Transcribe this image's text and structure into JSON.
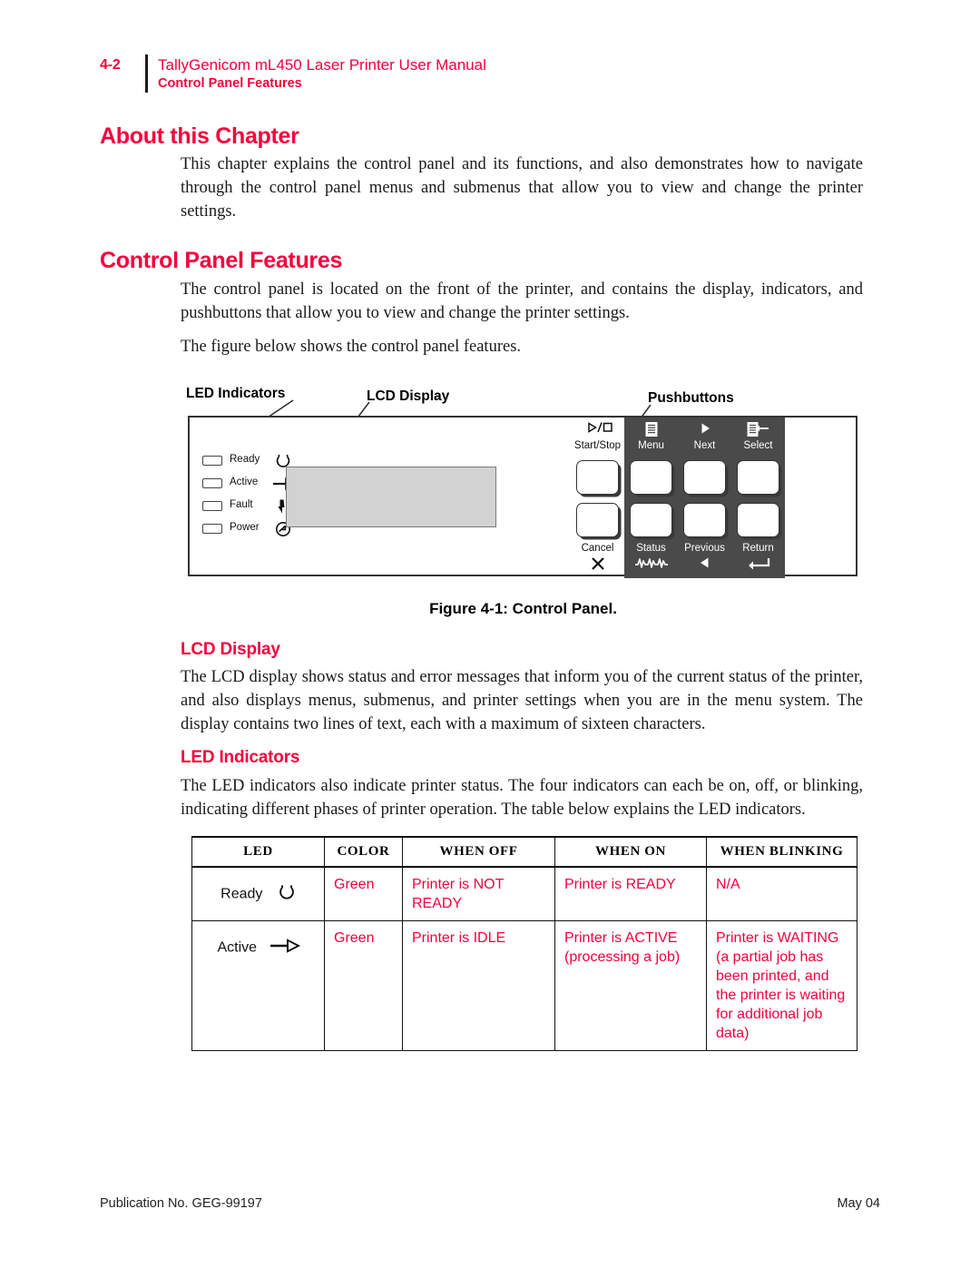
{
  "header": {
    "page_number": "4-2",
    "manual_title": "TallyGenicom mL450 Laser Printer User Manual",
    "section": "Control Panel Features"
  },
  "colors": {
    "accent_red": "#F5003C",
    "panel_outline": "#333333",
    "lcd_fill": "#D2D2D2",
    "key_dark": "#4A4A4A"
  },
  "sections": [
    {
      "heading": "About this Chapter",
      "paragraphs": [
        "This chapter explains the control panel and its functions, and also demonstrates how to navigate through the control panel menus and submenus that allow you to view and change the printer settings."
      ]
    },
    {
      "heading": "Control Panel Features",
      "paragraphs": [
        "The control panel is located on the front of the printer, and contains the display, indicators, and pushbuttons that allow you to view and change the printer settings.",
        "The figure below shows the control panel features."
      ]
    }
  ],
  "figure": {
    "callouts": {
      "led_indicators": "LED Indicators",
      "lcd_display": "LCD Display",
      "pushbuttons": "Pushbuttons"
    },
    "leds": [
      {
        "label": "Ready",
        "icon": "ready-circle-icon"
      },
      {
        "label": "Active",
        "icon": "active-arrow-icon"
      },
      {
        "label": "Fault",
        "icon": "fault-bolt-icon"
      },
      {
        "label": "Power",
        "icon": "power-icon"
      }
    ],
    "buttons_top": [
      {
        "label": "Start/Stop",
        "icon": "play-stop-icon",
        "dark": false
      },
      {
        "label": "Menu",
        "icon": "menu-list-icon",
        "dark": true
      },
      {
        "label": "Next",
        "icon": "right-triangle-icon",
        "dark": true
      },
      {
        "label": "Select",
        "icon": "select-arrow-icon",
        "dark": true
      }
    ],
    "buttons_bottom": [
      {
        "label": "Cancel",
        "icon": "x-icon",
        "dark": false
      },
      {
        "label": "Status",
        "icon": "waveform-icon",
        "dark": true
      },
      {
        "label": "Previous",
        "icon": "left-triangle-icon",
        "dark": true
      },
      {
        "label": "Return",
        "icon": "enter-arrow-icon",
        "dark": true
      }
    ],
    "caption": "Figure 4-1:  Control Panel."
  },
  "subsections": [
    {
      "heading": "LCD Display",
      "paragraph": "The LCD display shows status and error messages that inform you of the current status of the printer, and also displays menus, submenus, and printer settings when you are in the menu system. The display contains two lines of text, each with a maximum of sixteen characters."
    },
    {
      "heading": "LED Indicators",
      "paragraph": "The LED indicators also indicate printer status. The four indicators can each be on, off, or blinking, indicating different phases of printer operation. The table below explains the LED indicators."
    }
  ],
  "table": {
    "headers": [
      "LED",
      "COLOR",
      "WHEN OFF",
      "WHEN ON",
      "WHEN BLINKING"
    ],
    "rows": [
      {
        "led": "Ready",
        "led_icon": "ready-circle-icon",
        "color": "Green",
        "when_off": "Printer is NOT READY",
        "when_on": "Printer is READY",
        "when_blinking": "N/A"
      },
      {
        "led": "Active",
        "led_icon": "active-arrow-icon",
        "color": "Green",
        "when_off": "Printer is IDLE",
        "when_on": "Printer is ACTIVE (processing a job)",
        "when_blinking": "Printer is WAITING (a partial job has been printed, and the printer is waiting for additional job data)"
      }
    ]
  },
  "footer": {
    "publication": "Publication No. GEG-99197",
    "date": "May 04"
  }
}
